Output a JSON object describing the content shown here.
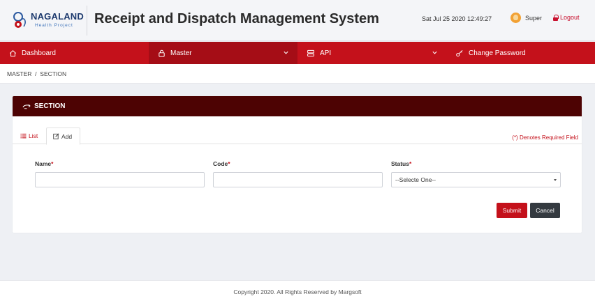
{
  "header": {
    "logo_text": "NAGALAND",
    "logo_subtext": "Health Project",
    "app_title": "Receipt and Dispatch Management System",
    "datetime": "Sat Jul 25 2020 12:49:27",
    "user_name": "Super",
    "logout_label": "Logout",
    "brand_color": "#c4111b"
  },
  "nav": {
    "items": [
      {
        "label": "Dashboard",
        "icon": "home-icon"
      },
      {
        "label": "Master",
        "icon": "lock-icon",
        "active": true,
        "has_dropdown": true
      },
      {
        "label": "API",
        "icon": "server-icon",
        "has_dropdown": true
      },
      {
        "label": "Change Password",
        "icon": "key-icon"
      }
    ]
  },
  "breadcrumb": {
    "items": [
      "MASTER",
      "SECTION"
    ],
    "separator": "/"
  },
  "card": {
    "title": "SECTION",
    "tabs": [
      {
        "label": "List",
        "icon": "list-icon"
      },
      {
        "label": "Add",
        "icon": "edit-icon",
        "active": true
      }
    ],
    "required_note": "(*) Denotes Required Field",
    "fields": {
      "name": {
        "label": "Name",
        "required_mark": "*",
        "value": ""
      },
      "code": {
        "label": "Code",
        "required_mark": "*",
        "value": ""
      },
      "status": {
        "label": "Status",
        "required_mark": "*",
        "selected": "--Selecte One--"
      }
    },
    "submit_label": "Submit",
    "cancel_label": "Cancel"
  },
  "footer": {
    "text": "Copyright 2020. All Rights Reserved by Margsoft"
  }
}
